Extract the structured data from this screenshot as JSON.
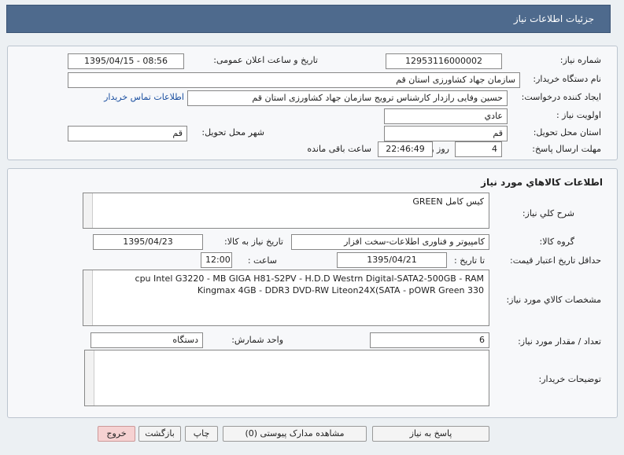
{
  "header": {
    "title": "جزئیات اطلاعات نیاز"
  },
  "info": {
    "need_number_label": "شماره نیاز:",
    "need_number": "12953116000002",
    "announce_label": "تاریخ و ساعت اعلان عمومی:",
    "announce_value": "1395/04/15 - 08:56",
    "buyer_org_label": "نام دستگاه خریدار:",
    "buyer_org": "سازمان جهاد کشاورزی استان قم",
    "creator_label": "ایجاد کننده درخواست:",
    "creator": "حسین وفایی رازدار کارشناس ترویج سازمان جهاد کشاورزی استان قم",
    "contact_link": "اطلاعات تماس خریدار",
    "priority_label": "اولویت نیاز :",
    "priority": "عادي",
    "province_label": "استان محل تحویل:",
    "province": "قم",
    "city_label": "شهر محل تحویل:",
    "city": "قم",
    "deadline_label": "مهلت ارسال پاسخ:",
    "days": "4",
    "days_label": "روز و",
    "time_remaining": "22:46:49",
    "remaining_label": "ساعت باقی مانده"
  },
  "goods": {
    "section_title": "اطلاعات كالاهاي مورد نياز",
    "summary_label": "شرح کلي نياز:",
    "summary": "کیس کامل GREEN",
    "group_label": "گروه کالا:",
    "group": "کامپیوتر و فناوری اطلاعات-سخت افزار",
    "need_date_label": "تاریخ نیاز به کالا:",
    "need_date": "1395/04/23",
    "min_validity_label": "حداقل تاریخ اعتبار قیمت:",
    "to_date_label": "تا تاریخ :",
    "to_date": "1395/04/21",
    "time_label": "ساعت :",
    "time": "12:00",
    "spec_label": "مشخصات كالاي مورد نياز:",
    "spec": "cpu Intel G3220 - MB GIGA H81-S2PV - H.D.D Westrn Digital-SATA2-500GB - RAM Kingmax 4GB - DDR3 DVD-RW Liteon24X(SATA - pOWR Green 330",
    "qty_label": "تعداد / مقدار مورد نیاز:",
    "qty": "6",
    "unit_label": "واحد شمارش:",
    "unit": "دستگاه",
    "buyer_notes_label": "توضیحات خریدار:",
    "buyer_notes": ""
  },
  "actions": {
    "reply": "پاسخ به نیاز",
    "attachments": "مشاهده مدارک پیوستی (0)",
    "print": "چاپ",
    "back": "بازگشت",
    "exit": "خروج"
  }
}
